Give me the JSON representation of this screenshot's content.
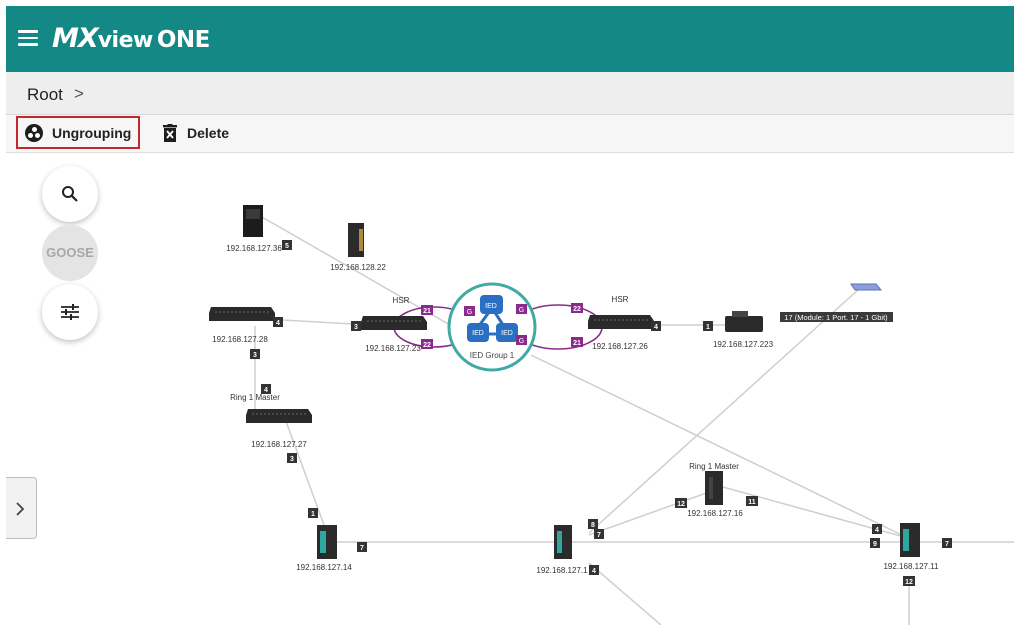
{
  "app": {
    "title_mx": "MX",
    "title_view": "view",
    "title_one": "ONE"
  },
  "breadcrumb": {
    "root": "Root",
    "chevron": ">"
  },
  "toolbar": {
    "ungroup_label": "Ungrouping",
    "delete_label": "Delete"
  },
  "fabs": {
    "search_icon": "search-icon",
    "goose_label": "GOOSE",
    "filter_icon": "tune-icon"
  },
  "icons": {
    "menu": "menu-icon",
    "ungroup": "ungroup-icon",
    "delete": "delete-icon",
    "side_panel": "chevron-right-icon"
  },
  "colors": {
    "header": "#138884",
    "accent_border": "#c0282d",
    "group_ring": "#3fa9a4",
    "ied": "#2b6fc2",
    "hsr_link": "#8a2b8c",
    "port_badge": "#333333"
  },
  "topology": {
    "devices": {
      "d36": "192.168.127.36",
      "d22": "192.168.128.22",
      "d28": "192.168.127.28",
      "d23": "192.168.127.23",
      "d26": "192.168.127.26",
      "d223": "192.168.127.223",
      "d27": "192.168.127.27",
      "d14": "192.168.127.14",
      "d1x": "192.168.127.1",
      "d16": "192.168.127.16",
      "d11": "192.168.127.11"
    },
    "labels": {
      "hsr_left": "HSR",
      "hsr_right": "HSR",
      "ring_left": "Ring 1 Master",
      "ring_mid": "Ring 1 Master",
      "ied_group": "IED Group 1",
      "ied": "IED",
      "goose_g": "G",
      "tooltip": "17 (Module: 1 Port. 17 - 1 Gbit)"
    },
    "ports": {
      "p5": "5",
      "p4a": "4",
      "p3a": "3",
      "p21a": "21",
      "p22a": "22",
      "p22b": "22",
      "p21b": "21",
      "p4b": "4",
      "p1a": "1",
      "p3b": "3",
      "p4c": "4",
      "p3c": "3",
      "p1b": "1",
      "p7a": "7",
      "p8": "8",
      "p7b": "7",
      "p4d": "4",
      "p12a": "12",
      "p11": "11",
      "p4e": "4",
      "p9": "9",
      "p7c": "7",
      "p12b": "12"
    }
  }
}
